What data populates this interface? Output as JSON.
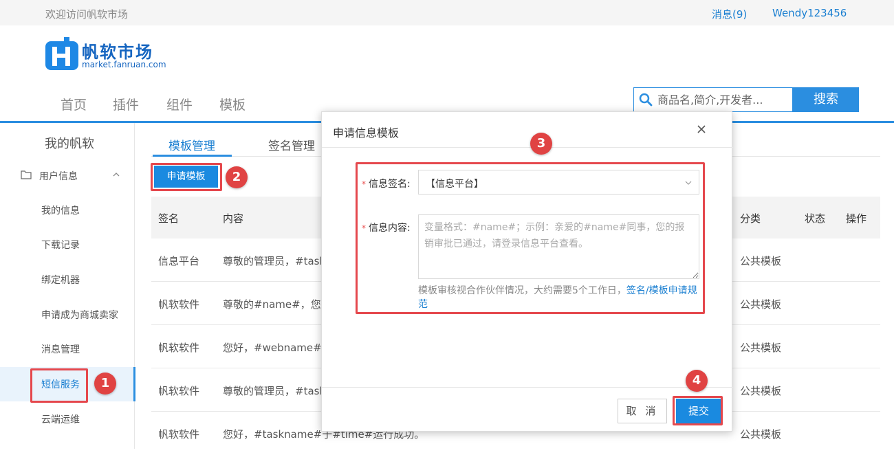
{
  "topbar": {
    "welcome": "欢迎访问帆软市场",
    "messages": "消息(9)",
    "username": "Wendy123456"
  },
  "logo": {
    "name": "帆软市场",
    "url": "market.fanruan.com",
    "brand_color": "#1565c0"
  },
  "nav": {
    "items": [
      "首页",
      "插件",
      "组件",
      "模板"
    ]
  },
  "search": {
    "placeholder": "商品名,简介,开发者...",
    "button": "搜索"
  },
  "sidebar": {
    "title": "我的帆软",
    "group": "用户信息",
    "items": [
      "我的信息",
      "下载记录",
      "绑定机器",
      "申请成为商城卖家",
      "消息管理",
      "短信服务",
      "云端运维"
    ],
    "active_item": "短信服务"
  },
  "tabs": {
    "items": [
      "模板管理",
      "签名管理"
    ],
    "active": "模板管理"
  },
  "apply_button": "申请模板",
  "table": {
    "headers": {
      "sign": "签名",
      "content": "内容",
      "category": "分类",
      "status": "状态",
      "action": "操作"
    },
    "rows": [
      {
        "sign": "信息平台",
        "content": "尊敬的管理员，#taskn",
        "category": "公共模板"
      },
      {
        "sign": "帆软软件",
        "content": "尊敬的#name#，您有",
        "category": "公共模板"
      },
      {
        "sign": "帆软软件",
        "content": "您好，#webname#系",
        "category": "公共模板"
      },
      {
        "sign": "帆软软件",
        "content": "尊敬的管理员，#taskn",
        "category": "公共模板"
      },
      {
        "sign": "帆软软件",
        "content": "您好，#taskname#于#time#运行成功。",
        "category": "公共模板"
      }
    ]
  },
  "modal": {
    "title": "申请信息模板",
    "sign_label": "信息签名:",
    "sign_value": "【信息平台】",
    "content_label": "信息内容:",
    "content_placeholder": "变量格式：#name#；示例：亲爱的#name#同事，您的报销审批已通过，请登录信息平台查看。",
    "hint": "模板审核视合作伙伴情况，大约需要5个工作日，",
    "hint_link": "签名/模板申请规范",
    "cancel": "取 消",
    "submit": "提交"
  },
  "annotations": [
    "1",
    "2",
    "3",
    "4"
  ],
  "colors": {
    "accent": "#2b8ee0",
    "highlight": "#e5484d",
    "badge": "#e04343"
  }
}
